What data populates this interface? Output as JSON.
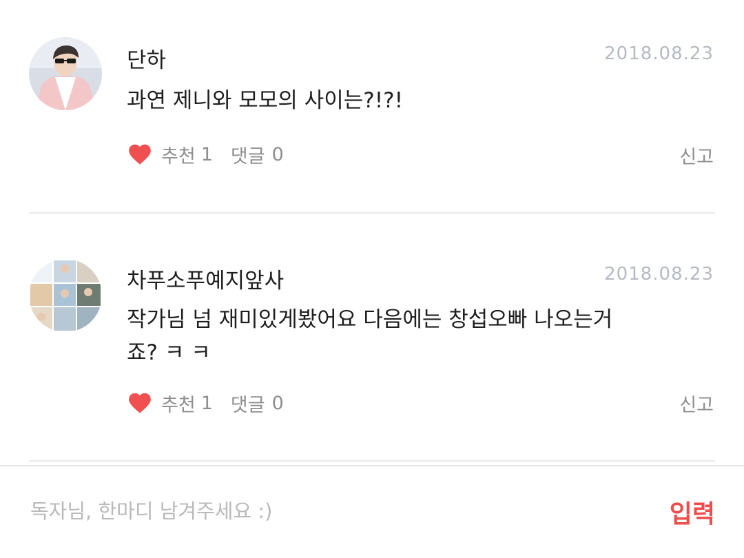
{
  "comments": [
    {
      "username": "단하",
      "date": "2018.08.23",
      "text": "과연 제니와 모모의 사이는?!?!",
      "like_label": "추천",
      "like_count": "1",
      "reply_label": "댓글",
      "reply_count": "0",
      "report_label": "신고",
      "avatar_icon": "profile-photo"
    },
    {
      "username": "차푸소푸예지앞사",
      "date": "2018.08.23",
      "text": "작가님 넘 재미있게봤어요 다음에는 창섭오빠 나오는거죠? ㅋ ㅋ",
      "like_label": "추천",
      "like_count": "1",
      "reply_label": "댓글",
      "reply_count": "0",
      "report_label": "신고",
      "avatar_icon": "photo-collage"
    }
  ],
  "input": {
    "placeholder": "독자님, 한마디 남겨주세요 :)",
    "value": "",
    "submit_label": "입력"
  },
  "colors": {
    "heart": "#f05050",
    "accent": "#f04c4c",
    "date": "#b4bac2",
    "meta": "#8e8e8e",
    "divider": "#e8eaee"
  },
  "icons": {
    "like": "heart-icon"
  }
}
